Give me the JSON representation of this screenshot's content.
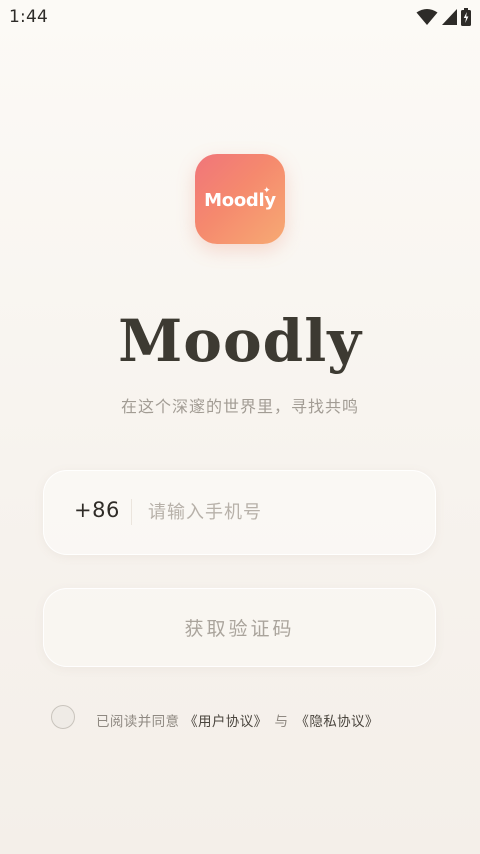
{
  "status_bar": {
    "time": "1:44",
    "icons": [
      "wifi-icon",
      "signal-icon",
      "battery-charging-icon"
    ]
  },
  "logo": {
    "text": "Moodly",
    "sparkle": "✦",
    "gradient": [
      "#f0757a",
      "#f7aa73"
    ]
  },
  "title": "Moodly",
  "tagline": "在这个深邃的世界里，寻找共鸣",
  "phone": {
    "country_code": "+86",
    "placeholder": "请输入手机号",
    "value": ""
  },
  "get_code_label": "获取验证码",
  "agreement": {
    "prefix": "已阅读并同意",
    "user_agreement": "《用户协议》",
    "joiner": "与",
    "privacy_agreement": "《隐私协议》",
    "checked": false
  },
  "colors": {
    "title": "#3d3a32",
    "muted": "#a29c94",
    "background": "#f7f3ee"
  }
}
